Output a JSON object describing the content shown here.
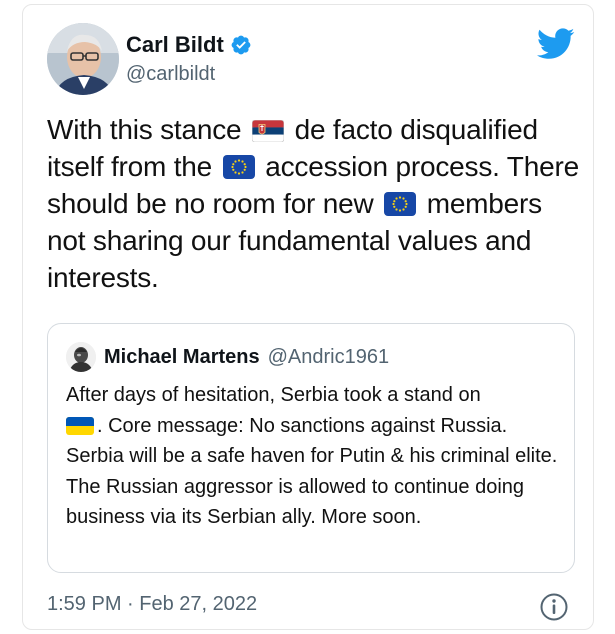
{
  "tweet": {
    "display_name": "Carl Bildt",
    "handle": "@carlbildt",
    "text_parts": [
      "With this stance ",
      " de facto disqualified itself from the ",
      " accession process. There should be no room for new ",
      " members not sharing our fundamental values and interests."
    ],
    "flag_icons": [
      "serbia-flag-icon",
      "eu-flag-icon",
      "eu-flag-icon"
    ],
    "timestamp": "1:59 PM · Feb 27, 2022"
  },
  "quote": {
    "display_name": "Michael Martens",
    "handle": "@Andric1961",
    "text_parts": [
      "After days of hesitation, Serbia took a stand on ",
      ". Core message: No sanctions against Russia. Serbia will be a safe haven for Putin & his criminal elite. The Russian aggressor is allowed to continue doing business via its Serbian ally. More soon."
    ],
    "flag_icons": [
      "ukraine-flag-icon"
    ]
  },
  "icons": {
    "verified": "verified-badge-icon",
    "brand": "twitter-bird-icon",
    "info": "info-icon"
  },
  "colors": {
    "twitter_blue": "#1d9bf0",
    "secondary_text": "#536471",
    "primary_text": "#0f1419",
    "eu_blue": "#1747a6",
    "eu_star": "#f7d117",
    "ukraine_blue": "#0057b7",
    "ukraine_yellow": "#ffd700",
    "serbia_red": "#c6363c",
    "serbia_blue": "#0c4076"
  }
}
